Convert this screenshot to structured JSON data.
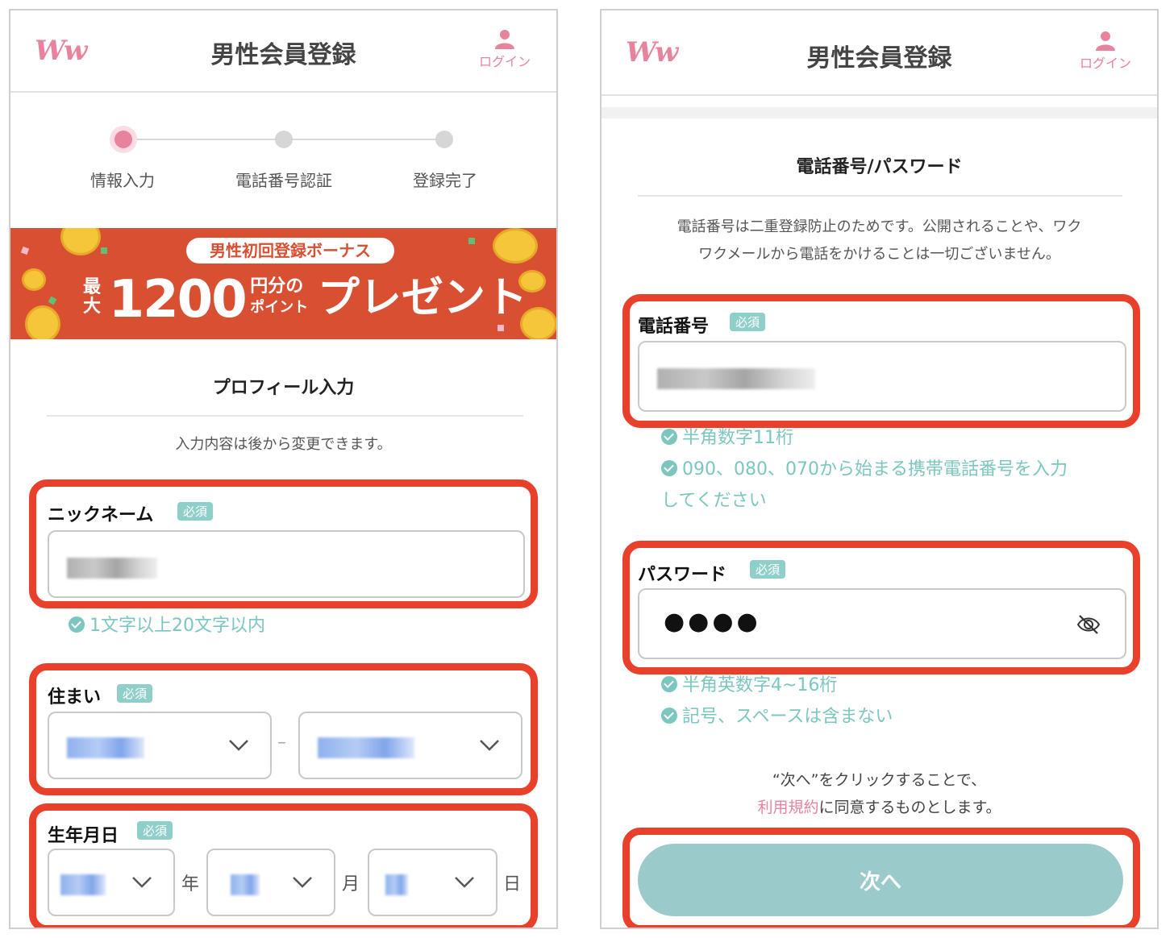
{
  "left": {
    "header": {
      "logo": "Ww",
      "title": "男性会員登録",
      "login": "ログイン"
    },
    "steps": [
      "情報入力",
      "電話番号認証",
      "登録完了"
    ],
    "banner": {
      "pill": "男性初回登録ボーナス",
      "max": "最大",
      "amount": "1200",
      "unit_top": "円分の",
      "unit_bottom": "ポイント",
      "present": "プレゼント"
    },
    "section_title": "プロフィール入力",
    "note": "入力内容は後から変更できます。",
    "nickname": {
      "label": "ニックネーム",
      "required": "必須",
      "hint": "1文字以上20文字以内"
    },
    "residence": {
      "label": "住まい",
      "required": "必須",
      "separator": "–"
    },
    "birthday": {
      "label": "生年月日",
      "required": "必須",
      "year": "年",
      "month": "月",
      "day": "日"
    }
  },
  "right": {
    "header": {
      "logo": "Ww",
      "title": "男性会員登録",
      "login": "ログイン"
    },
    "section_title": "電話番号/パスワード",
    "note_line1": "電話番号は二重登録防止のためです。公開されることや、ワク",
    "note_line2": "ワクメールから電話をかけることは一切ございません。",
    "phone": {
      "label": "電話番号",
      "required": "必須",
      "hint1": "半角数字11桁",
      "hint2_line1": "090、080、070から始まる携帯電話番号を入力",
      "hint2_line2": "してください"
    },
    "password": {
      "label": "パスワード",
      "required": "必須",
      "value": "●●●●",
      "hint1": "半角英数字4~16桁",
      "hint2": "記号、スペースは含まない"
    },
    "terms_line1": "“次へ”をクリックすることで、",
    "terms_link": "利用規約",
    "terms_rest": "に同意するものとします。",
    "next_button": "次へ"
  },
  "colors": {
    "accent_pink": "#e8839d",
    "teal": "#7cc6c0",
    "button": "#9acbca",
    "highlight_red": "#e8402a",
    "banner": "#d94f32"
  }
}
